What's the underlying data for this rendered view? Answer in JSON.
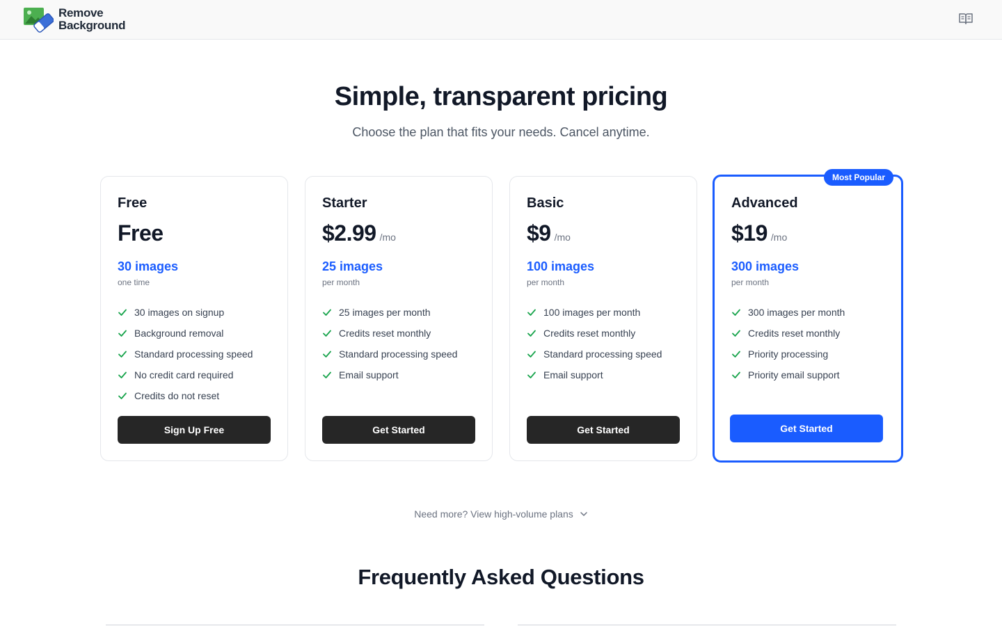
{
  "header": {
    "logo_line1": "Remove",
    "logo_line2": "Background",
    "docs_icon": "book-open-icon"
  },
  "hero": {
    "title": "Simple, transparent pricing",
    "subtitle": "Choose the plan that fits your needs. Cancel anytime."
  },
  "plans": [
    {
      "name": "Free",
      "price": "Free",
      "per": "",
      "images": "30 images",
      "period": "one time",
      "features": [
        "30 images on signup",
        "Background removal",
        "Standard processing speed",
        "No credit card required",
        "Credits do not reset"
      ],
      "cta": "Sign Up Free"
    },
    {
      "name": "Starter",
      "price": "$2.99",
      "per": "/mo",
      "images": "25 images",
      "period": "per month",
      "features": [
        "25 images per month",
        "Credits reset monthly",
        "Standard processing speed",
        "Email support"
      ],
      "cta": "Get Started"
    },
    {
      "name": "Basic",
      "price": "$9",
      "per": "/mo",
      "images": "100 images",
      "period": "per month",
      "features": [
        "100 images per month",
        "Credits reset monthly",
        "Standard processing speed",
        "Email support"
      ],
      "cta": "Get Started"
    },
    {
      "name": "Advanced",
      "price": "$19",
      "per": "/mo",
      "images": "300 images",
      "period": "per month",
      "badge": "Most Popular",
      "features": [
        "300 images per month",
        "Credits reset monthly",
        "Priority processing",
        "Priority email support"
      ],
      "cta": "Get Started"
    }
  ],
  "more_plans": "Need more? View high-volume plans",
  "faq": {
    "title": "Frequently Asked Questions"
  },
  "colors": {
    "accent": "#1a5cff",
    "check": "#16a34a",
    "button_dark": "#262626"
  }
}
